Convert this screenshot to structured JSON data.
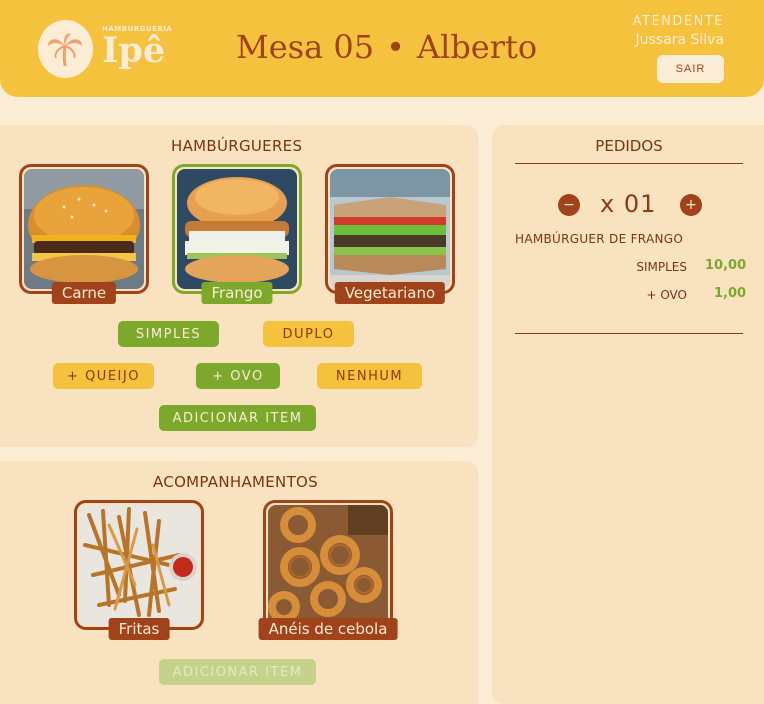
{
  "header": {
    "brand_small": "HAMBURGUERIA",
    "brand_name": "Ipê",
    "mesa": "Mesa 05",
    "separator": "•",
    "customer": "Alberto",
    "attendant_label": "ATENDENTE",
    "attendant_name": "Jussara Silva",
    "logout_label": "SAIR"
  },
  "burgers": {
    "title": "HAMBÚRGUERES",
    "items": [
      {
        "label": "Carne",
        "selected": false
      },
      {
        "label": "Frango",
        "selected": true
      },
      {
        "label": "Vegetariano",
        "selected": false
      }
    ],
    "size_options": [
      {
        "label": "SIMPLES",
        "selected": true
      },
      {
        "label": "DUPLO",
        "selected": false
      }
    ],
    "extra_options": [
      {
        "label": "+ QUEIJO",
        "selected": false
      },
      {
        "label": "+ OVO",
        "selected": true
      },
      {
        "label": "NENHUM",
        "selected": false
      }
    ],
    "add_label": "ADICIONAR ITEM"
  },
  "sides": {
    "title": "ACOMPANHAMENTOS",
    "items": [
      {
        "label": "Fritas"
      },
      {
        "label": "Anéis de cebola"
      }
    ],
    "add_label": "ADICIONAR ITEM"
  },
  "orders": {
    "title": "PEDIDOS",
    "minus": "−",
    "plus": "+",
    "quantity": "x 01",
    "item_name": "HAMBÚRGUER DE FRANGO",
    "lines": [
      {
        "label": "SIMPLES",
        "price": "10,00"
      },
      {
        "label": "+ OVO",
        "price": "1,00"
      }
    ]
  },
  "colors": {
    "header_bg": "#f5c23e",
    "page_bg": "#fbecd6",
    "panel_bg": "#f9e2c0",
    "brand_brown": "#a0421a",
    "accent_green": "#7ca82b"
  }
}
